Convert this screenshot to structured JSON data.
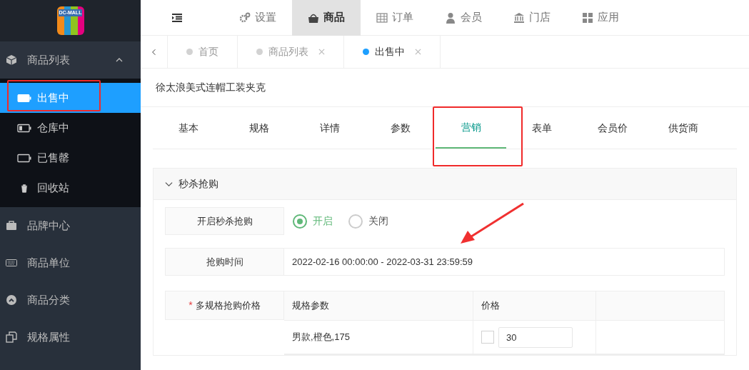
{
  "logo": {
    "text": "DC-MALL"
  },
  "sidebar": {
    "items": [
      {
        "label": "商品列表",
        "expanded": true,
        "children": [
          {
            "label": "出售中",
            "selected": true,
            "highlighted": true
          },
          {
            "label": "仓库中",
            "selected": false,
            "highlighted": false
          },
          {
            "label": "已售罄",
            "selected": false,
            "highlighted": false
          },
          {
            "label": "回收站",
            "selected": false,
            "highlighted": false
          }
        ]
      },
      {
        "label": "品牌中心"
      },
      {
        "label": "商品单位"
      },
      {
        "label": "商品分类"
      },
      {
        "label": "规格属性"
      }
    ]
  },
  "top_nav": [
    {
      "label": "设置",
      "selected": false
    },
    {
      "label": "商品",
      "selected": true
    },
    {
      "label": "订单",
      "selected": false
    },
    {
      "label": "会员",
      "selected": false
    },
    {
      "label": "门店",
      "selected": false
    },
    {
      "label": "应用",
      "selected": false
    }
  ],
  "page_tabs": [
    {
      "label": "首页",
      "closable": false,
      "selected": false
    },
    {
      "label": "商品列表",
      "closable": true,
      "selected": false
    },
    {
      "label": "出售中",
      "closable": true,
      "selected": true
    }
  ],
  "product_title": "徐太浪美式连帽工装夹克",
  "form_tabs": [
    {
      "label": "基本",
      "selected": false,
      "highlighted": false
    },
    {
      "label": "规格",
      "selected": false,
      "highlighted": false
    },
    {
      "label": "详情",
      "selected": false,
      "highlighted": false
    },
    {
      "label": "参数",
      "selected": false,
      "highlighted": false
    },
    {
      "label": "营销",
      "selected": true,
      "highlighted": true
    },
    {
      "label": "表单",
      "selected": false,
      "highlighted": false
    },
    {
      "label": "会员价",
      "selected": false,
      "highlighted": false
    },
    {
      "label": "供货商",
      "selected": false,
      "highlighted": false
    }
  ],
  "section": {
    "title": "秒杀抢购",
    "expanded": true,
    "enable_row": {
      "label": "开启秒杀抢购",
      "options": [
        {
          "label": "开启",
          "selected": true
        },
        {
          "label": "关闭",
          "selected": false
        }
      ]
    },
    "time_row": {
      "label": "抢购时间",
      "value": "2022-02-16 00:00:00 - 2022-03-31 23:59:59",
      "pointer_arrow": true
    },
    "price_row": {
      "label": "多规格抢购价格",
      "required_mark": "*",
      "columns": [
        "规格参数",
        "价格"
      ],
      "rows": [
        {
          "spec": "男款,橙色,175",
          "checked": false,
          "price": "30"
        }
      ]
    }
  }
}
